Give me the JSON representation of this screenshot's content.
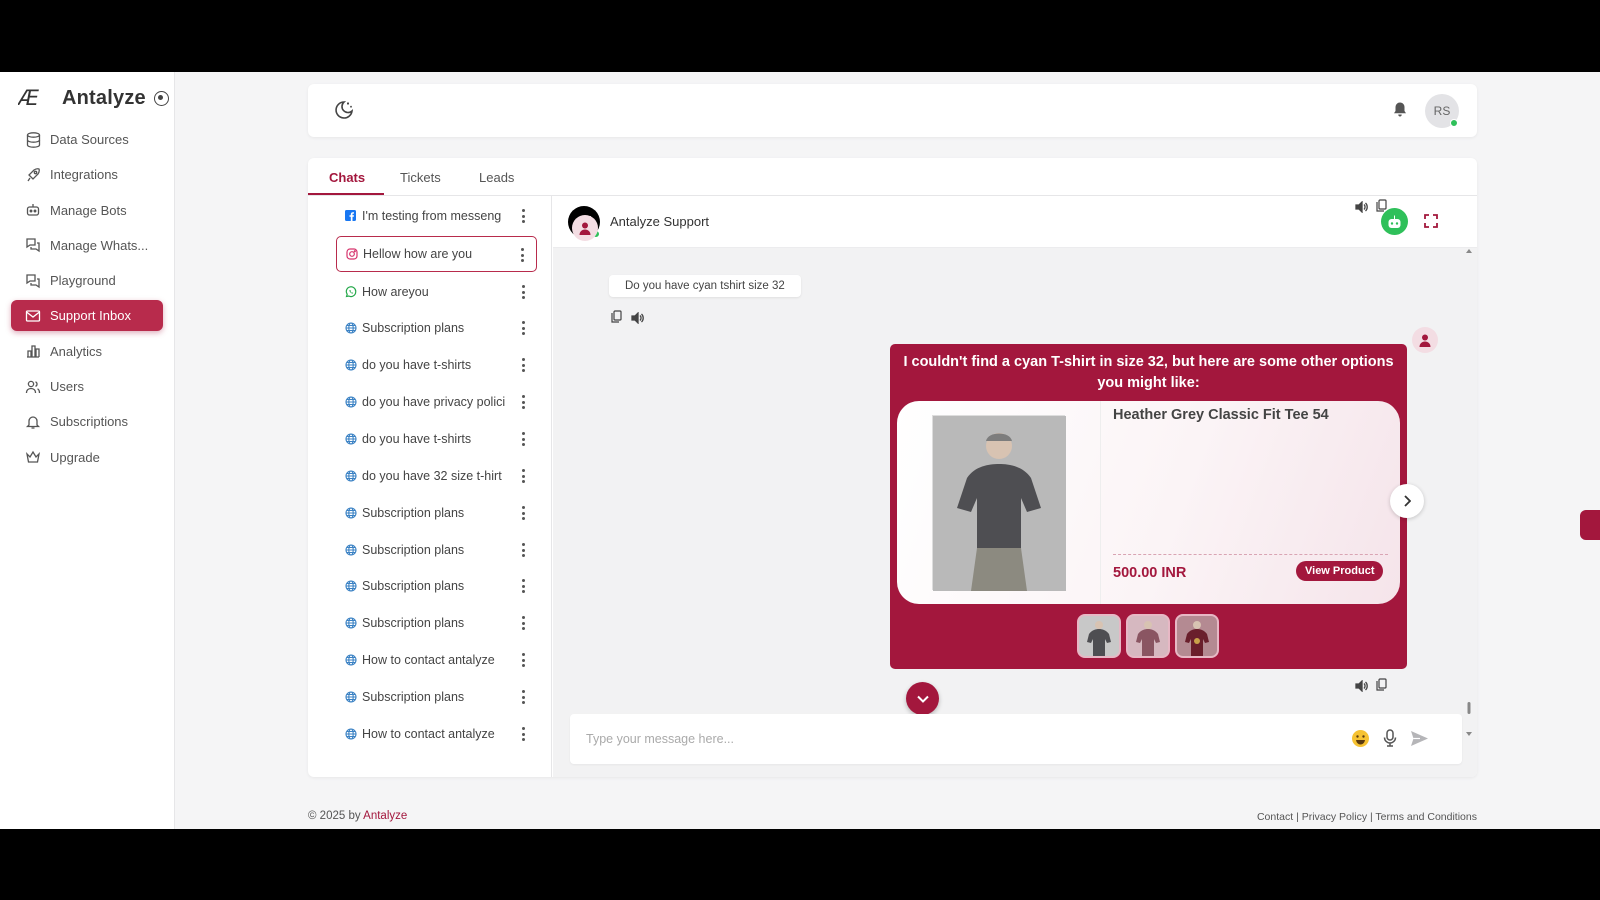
{
  "brand": {
    "name": "Antalyze",
    "logo_text": "Æ"
  },
  "sidebar": {
    "items": [
      {
        "label": "Data Sources",
        "icon": "database-icon"
      },
      {
        "label": "Integrations",
        "icon": "rocket-icon"
      },
      {
        "label": "Manage Bots",
        "icon": "bot-icon"
      },
      {
        "label": "Manage Whats...",
        "icon": "chat-bubbles-icon"
      },
      {
        "label": "Playground",
        "icon": "chat-bubbles-icon"
      },
      {
        "label": "Support Inbox",
        "icon": "inbox-icon",
        "active": true
      },
      {
        "label": "Analytics",
        "icon": "bar-chart-icon"
      },
      {
        "label": "Users",
        "icon": "users-icon"
      },
      {
        "label": "Subscriptions",
        "icon": "bell-icon"
      },
      {
        "label": "Upgrade",
        "icon": "crown-icon"
      }
    ]
  },
  "topbar": {
    "avatar_initials": "RS"
  },
  "tabs": [
    {
      "label": "Chats",
      "active": true
    },
    {
      "label": "Tickets"
    },
    {
      "label": "Leads"
    }
  ],
  "chats": [
    {
      "title": "I'm testing from messeng",
      "source": "facebook-icon"
    },
    {
      "title": "Hellow how are you",
      "source": "instagram-icon",
      "selected": true
    },
    {
      "title": "How areyou",
      "source": "whatsapp-icon"
    },
    {
      "title": "Subscription plans",
      "source": "globe-icon"
    },
    {
      "title": "do you have t-shirts",
      "source": "globe-icon"
    },
    {
      "title": "do you have privacy polici",
      "source": "globe-icon"
    },
    {
      "title": "do you have t-shirts",
      "source": "globe-icon"
    },
    {
      "title": "do you have 32 size t-hirt",
      "source": "globe-icon"
    },
    {
      "title": "Subscription plans",
      "source": "globe-icon"
    },
    {
      "title": "Subscription plans",
      "source": "globe-icon"
    },
    {
      "title": "Subscription plans",
      "source": "globe-icon"
    },
    {
      "title": "Subscription plans",
      "source": "globe-icon"
    },
    {
      "title": "How to contact antalyze",
      "source": "globe-icon"
    },
    {
      "title": "Subscription plans",
      "source": "globe-icon"
    },
    {
      "title": "How to contact antalyze",
      "source": "globe-icon"
    }
  ],
  "conversation": {
    "title": "Antalyze Support",
    "user_message": "Do you have cyan tshirt size 32",
    "bot_message": "I couldn't find a cyan T-shirt in size 32, but here are some other options you might like:",
    "product": {
      "name": "Heather Grey Classic Fit Tee 54",
      "price": "500.00 INR",
      "button": "View Product"
    },
    "composer_placeholder": "Type your message here..."
  },
  "footer": {
    "copyright": "© 2025  by ",
    "brand_link": "Antalyze",
    "links": "Contact |  Privacy Policy |  Terms and Conditions"
  },
  "colors": {
    "accent": "#a3173d",
    "online": "#2fc05a"
  }
}
